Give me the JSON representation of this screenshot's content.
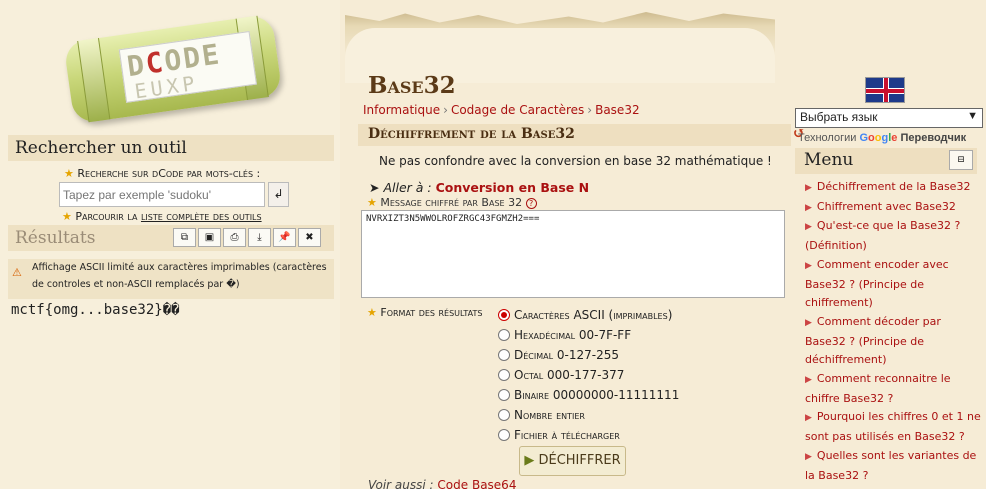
{
  "left": {
    "logo_text": "DCODE",
    "search_title": "Rechercher un outil",
    "keyword_label": "Recherche sur dCode par mots-clés :",
    "search_placeholder": "Tapez par exemple 'sudoku'",
    "list_prefix": "Parcourir la",
    "list_link": "liste complète des outils",
    "results_title": "Résultats",
    "warning": "Affichage ASCII limité aux caractères imprimables (caractères de controles et non-ASCII remplacés par �)",
    "result_value": "mctf{omg...base32}��"
  },
  "center": {
    "title": "Base32",
    "breadcrumbs": [
      "Informatique",
      "Codage de Caractères",
      "Base32"
    ],
    "section_title": "Déchiffrement de la Base32",
    "note": "Ne pas confondre avec la conversion en base 32 mathématique !",
    "goto_prefix": "Aller à :",
    "goto_link": "Conversion en Base N",
    "message_label": "Message chiffré par Base 32",
    "message_value": "NVRXIZT3N5WWOLROFZRGC43FGMZH2===",
    "format_label": "Format des résultats",
    "format_options": [
      "Caractères ASCII (imprimables)",
      "Hexadécimal 00-7F-FF",
      "Décimal 0-127-255",
      "Octal 000-177-377",
      "Binaire 00000000-11111111",
      "Nombre entier",
      "Fichier à télécharger"
    ],
    "selected_format": 0,
    "decrypt_button": "DÉCHIFFRER",
    "see_also_prefix": "Voir aussi :",
    "see_also_link": "Code Base64"
  },
  "right": {
    "language_select": "Выбрать язык",
    "translator_prefix": "Технологии",
    "translator_google": "Google",
    "translator_name": "Переводчик",
    "menu_title": "Menu",
    "menu_items": [
      "Déchiffrement de la Base32",
      "Chiffrement avec Base32",
      "Qu'est-ce que la Base32 ? (Définition)",
      "Comment encoder avec Base32 ? (Principe de chiffrement)",
      "Comment décoder par Base32 ? (Principe de déchiffrement)",
      "Comment reconnaitre le chiffre Base32 ?",
      "Pourquoi les chiffres 0 et 1 ne sont pas utilisés en Base32 ?",
      "Quelles sont les variantes de la Base32 ?"
    ]
  }
}
